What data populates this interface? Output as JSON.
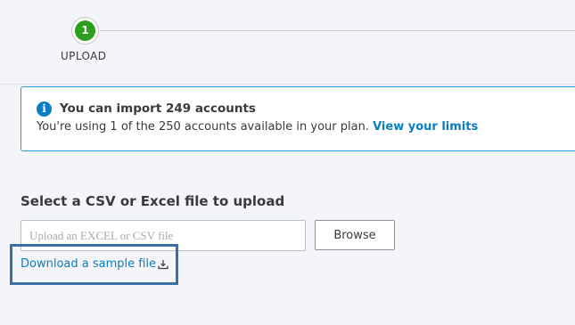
{
  "stepper": {
    "step_number": "1",
    "step_label": "UPLOAD"
  },
  "info": {
    "icon": "info-icon",
    "title": "You can import 249 accounts",
    "description": "You're using 1 of the 250 accounts available in your plan.",
    "link_label": "View your limits"
  },
  "upload": {
    "section_title": "Select a CSV or Excel file to upload",
    "input_placeholder": "Upload an EXCEL or CSV file",
    "input_value": "",
    "browse_label": "Browse",
    "download_label": "Download a sample file",
    "download_icon": "download-icon"
  },
  "colors": {
    "step_active": "#2ca01c",
    "link": "#0a7ec2",
    "info_border": "#2a9ad6",
    "highlight": "#3b6ea5",
    "background": "#f4f5f8"
  }
}
